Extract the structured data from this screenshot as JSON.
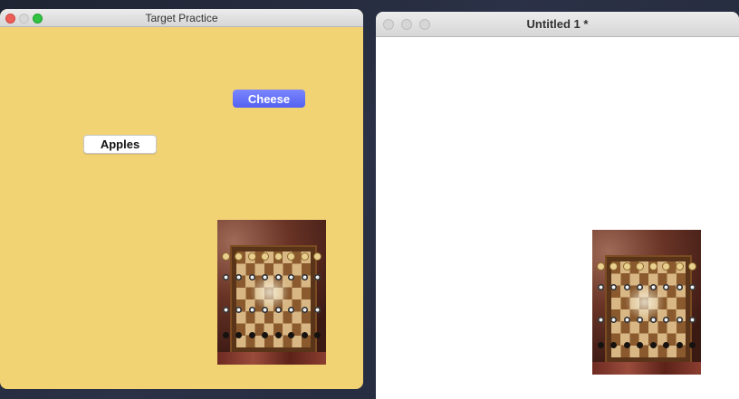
{
  "window1": {
    "title": "Target Practice",
    "background_color": "#f2d374",
    "buttons": {
      "cheese": {
        "label": "Cheese",
        "color": "#5c6cf6"
      },
      "apples": {
        "label": "Apples",
        "color": "#ffffff"
      }
    },
    "image": {
      "icon": "chessboard-photo"
    }
  },
  "window2": {
    "title": "Untitled 1 *",
    "background_color": "#ffffff",
    "image": {
      "icon": "chessboard-photo"
    }
  }
}
